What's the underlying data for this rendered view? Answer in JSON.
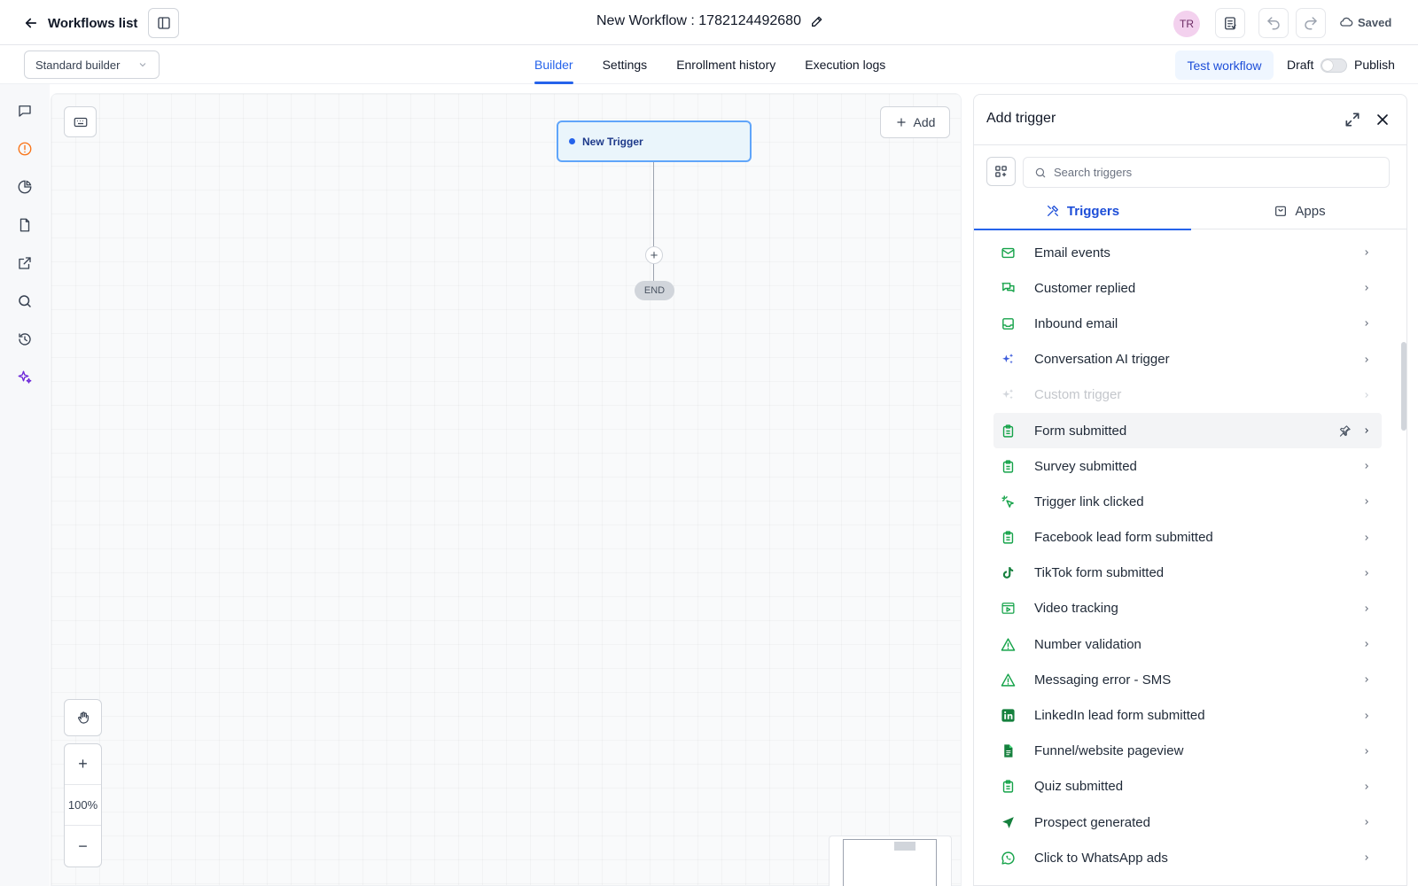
{
  "header": {
    "back_label": "Workflows list",
    "workflow_title": "New Workflow : 1782124492680",
    "avatar_initials": "TR",
    "saved_label": "Saved"
  },
  "subheader": {
    "builder_mode": "Standard builder",
    "tabs": [
      "Builder",
      "Settings",
      "Enrollment history",
      "Execution logs"
    ],
    "active_tab": "Builder",
    "test_label": "Test workflow",
    "draft_label": "Draft",
    "publish_label": "Publish",
    "publish_toggle_on": false
  },
  "canvas": {
    "add_label": "Add",
    "trigger_node_label": "New Trigger",
    "end_label": "END",
    "zoom_level": "100%",
    "zoom_in_symbol": "+",
    "zoom_out_symbol": "−"
  },
  "panel": {
    "title": "Add trigger",
    "search_placeholder": "Search triggers",
    "tabs": {
      "triggers": "Triggers",
      "apps": "Apps"
    },
    "items": [
      {
        "label": "Email events",
        "icon": "mail-icon"
      },
      {
        "label": "Customer replied",
        "icon": "chat-bubbles-icon"
      },
      {
        "label": "Inbound email",
        "icon": "inbox-icon"
      },
      {
        "label": "Conversation AI trigger",
        "icon": "ai-sparkle-icon"
      },
      {
        "label": "Custom trigger",
        "icon": "ai-sparkle-icon",
        "disabled": true
      },
      {
        "label": "Form submitted",
        "icon": "clipboard-icon",
        "hovered": true
      },
      {
        "label": "Survey submitted",
        "icon": "clipboard-icon"
      },
      {
        "label": "Trigger link clicked",
        "icon": "cursor-click-icon"
      },
      {
        "label": "Facebook lead form submitted",
        "icon": "clipboard-icon"
      },
      {
        "label": "TikTok form submitted",
        "icon": "tiktok-icon"
      },
      {
        "label": "Video tracking",
        "icon": "video-icon"
      },
      {
        "label": "Number validation",
        "icon": "warning-triangle-icon"
      },
      {
        "label": "Messaging error - SMS",
        "icon": "warning-triangle-icon"
      },
      {
        "label": "LinkedIn lead form submitted",
        "icon": "linkedin-icon"
      },
      {
        "label": "Funnel/website pageview",
        "icon": "document-icon"
      },
      {
        "label": "Quiz submitted",
        "icon": "clipboard-icon"
      },
      {
        "label": "Prospect generated",
        "icon": "navigation-arrow-icon"
      },
      {
        "label": "Click to WhatsApp ads",
        "icon": "whatsapp-icon"
      }
    ]
  },
  "colors": {
    "accent": "#2563eb",
    "icon_green": "#16a34a",
    "ai_blue": "#3b5bdb",
    "rail_orange": "#f97316",
    "rail_violet": "#6d28d9"
  }
}
